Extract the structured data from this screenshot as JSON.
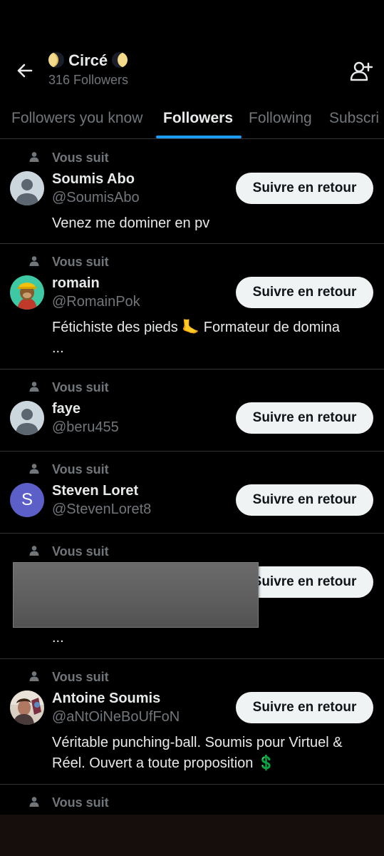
{
  "header": {
    "title": "Circé",
    "subtitle": "316 Followers",
    "icons": [
      "back-arrow-icon",
      "moon-icon",
      "add-person-icon"
    ]
  },
  "tabs": [
    {
      "label": "Followers you know",
      "active": false
    },
    {
      "label": "Followers",
      "active": true
    },
    {
      "label": "Following",
      "active": false
    },
    {
      "label": "Subscri",
      "active": false
    }
  ],
  "followers": [
    {
      "meta": "Vous suit",
      "name": "Soumis Abo",
      "handle": "@SoumisAbo",
      "bio": "Venez me dominer en pv",
      "bio2": "",
      "button": "Suivre en retour",
      "avatar": "default"
    },
    {
      "meta": "Vous suit",
      "name": "romain",
      "handle": "@RomainPok",
      "bio": "Fétichiste des pieds 🦶 Formateur de domina",
      "bio2": "...",
      "button": "Suivre en retour",
      "avatar": "ape"
    },
    {
      "meta": "Vous suit",
      "name": "faye",
      "handle": "@beru455",
      "bio": "",
      "bio2": "",
      "button": "Suivre en retour",
      "avatar": "default"
    },
    {
      "meta": "Vous suit",
      "name": "Steven Loret",
      "handle": "@StevenLoret8",
      "bio": "",
      "bio2": "",
      "button": "Suivre en retour",
      "avatar": "letter",
      "avatar_letter": "S"
    },
    {
      "meta": "Vous suit",
      "name": "",
      "handle": "",
      "bio": "",
      "bio2": "...",
      "button": "Suivre en retour",
      "avatar": "redacted"
    },
    {
      "meta": "Vous suit",
      "name": "Antoine Soumis",
      "handle": "@aNtOiNeBoUfFoN",
      "bio": "Véritable punching-ball. Soumis pour Virtuel &",
      "bio2": "Réel. Ouvert a toute proposition 💲",
      "button": "Suivre en retour",
      "avatar": "photo"
    },
    {
      "meta": "Vous suit"
    }
  ],
  "colors": {
    "background": "#000000",
    "text": "#e7e9ea",
    "muted": "#71767b",
    "accent": "#1d9bf0",
    "button_bg": "#eff3f4",
    "divider": "#2f3336",
    "letter_avatar": "#5b5fc7"
  }
}
